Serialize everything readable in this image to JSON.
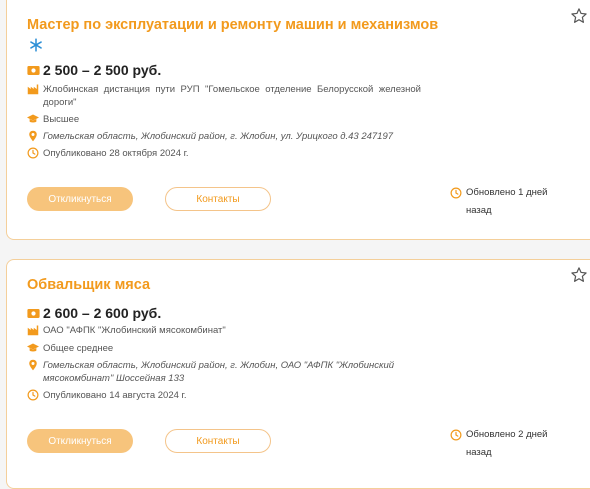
{
  "colors": {
    "accent": "#f29a1d",
    "button_bg": "#f7c47c",
    "card_border": "#f4cf9a"
  },
  "vacancies": [
    {
      "title": "Мастер по эксплуатации и ремонту машин и механизмов",
      "salary": "2 500 – 2 500 руб.",
      "employer": "Жлобинская дистанция пути РУП \"Гомельское отделение Белорусской железной дороги\"",
      "education": "Высшее",
      "address": "Гомельская область, Жлобинский район, г. Жлобин, ул. Урицкого д.43 247197",
      "published": "Опубликовано 28 октября 2024 г.",
      "apply_label": "Откликнуться",
      "contacts_label": "Контакты",
      "updated": "Обновлено 1 дней назад"
    },
    {
      "title": "Обвальщик мяса",
      "salary": "2 600 – 2 600 руб.",
      "employer": "ОАО \"АФПК \"Жлобинский мясокомбинат\"",
      "education": "Общее среднее",
      "address": "Гомельская область, Жлобинский район, г. Жлобин, ОАО \"АФПК \"Жлобинский мясокомбинат\" Шоссейная 133",
      "published": "Опубликовано 14 августа 2024 г.",
      "apply_label": "Откликнуться",
      "contacts_label": "Контакты",
      "updated": "Обновлено 2 дней назад"
    }
  ]
}
